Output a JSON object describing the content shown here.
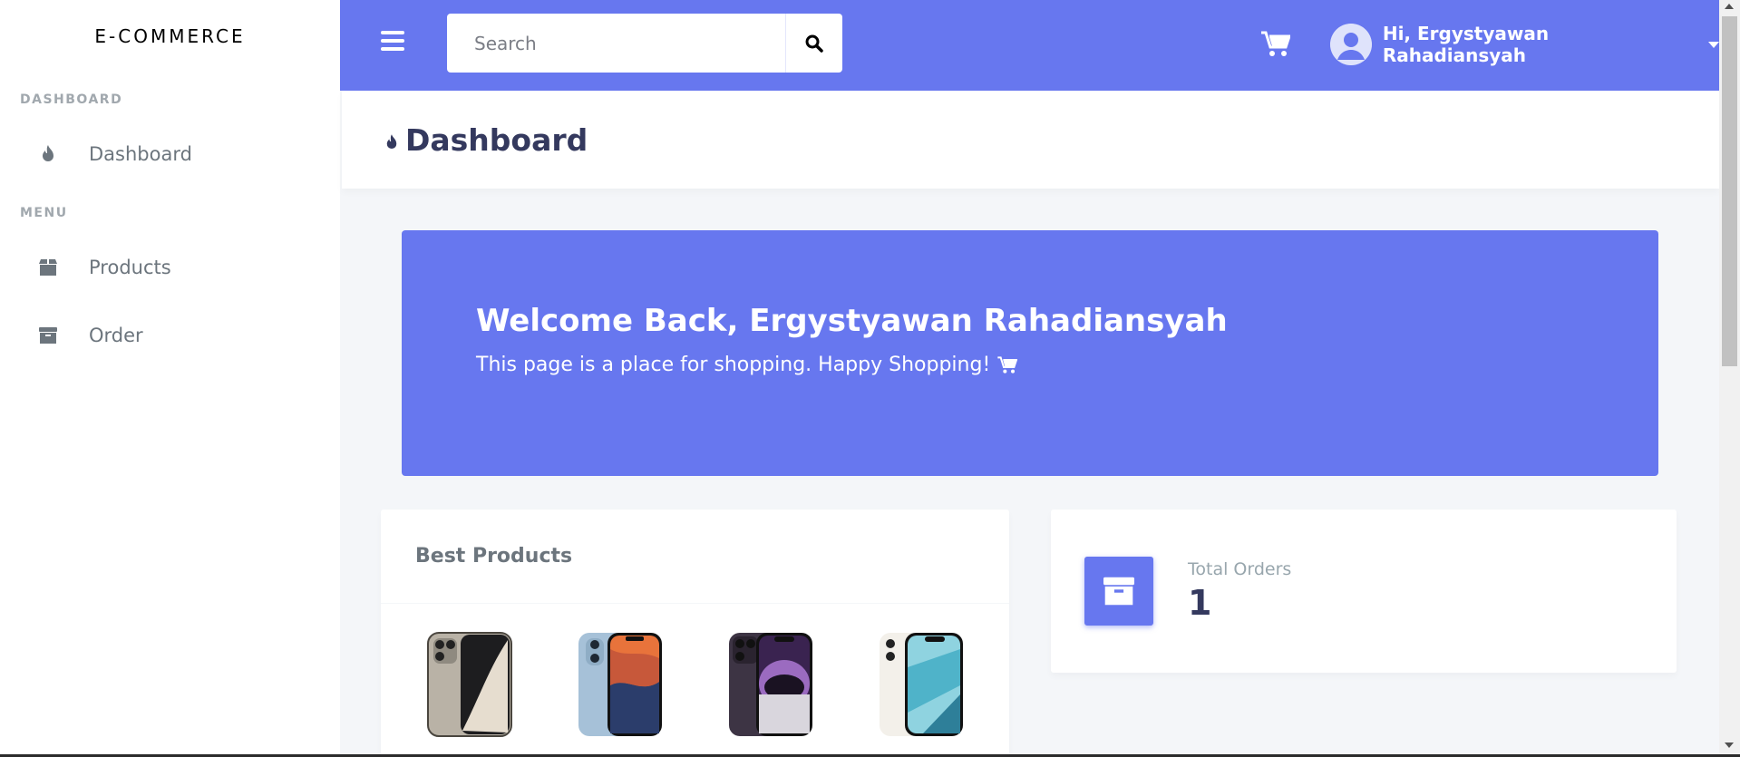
{
  "sidebar": {
    "brand": "E-COMMERCE",
    "sections": [
      {
        "header": "DASHBOARD",
        "items": [
          {
            "label": "Dashboard",
            "icon": "fire-icon"
          }
        ]
      },
      {
        "header": "MENU",
        "items": [
          {
            "label": "Products",
            "icon": "box-icon"
          },
          {
            "label": "Order",
            "icon": "archive-icon"
          }
        ]
      }
    ]
  },
  "topbar": {
    "search_placeholder": "Search",
    "user_name": "Hi, Ergystyawan Rahadiansyah",
    "accent": "#6777ef"
  },
  "page": {
    "title": "Dashboard"
  },
  "hero": {
    "title": "Welcome Back, Ergystyawan Rahadiansyah",
    "text": "This page is a place for shopping. Happy Shopping!"
  },
  "best_products": {
    "title": "Best Products",
    "items": [
      {
        "name": "natural-titanium-phone"
      },
      {
        "name": "blue-phone"
      },
      {
        "name": "deep-purple-phone"
      },
      {
        "name": "starlight-phone"
      }
    ]
  },
  "stats": {
    "total_orders_label": "Total Orders",
    "total_orders_value": "1"
  }
}
